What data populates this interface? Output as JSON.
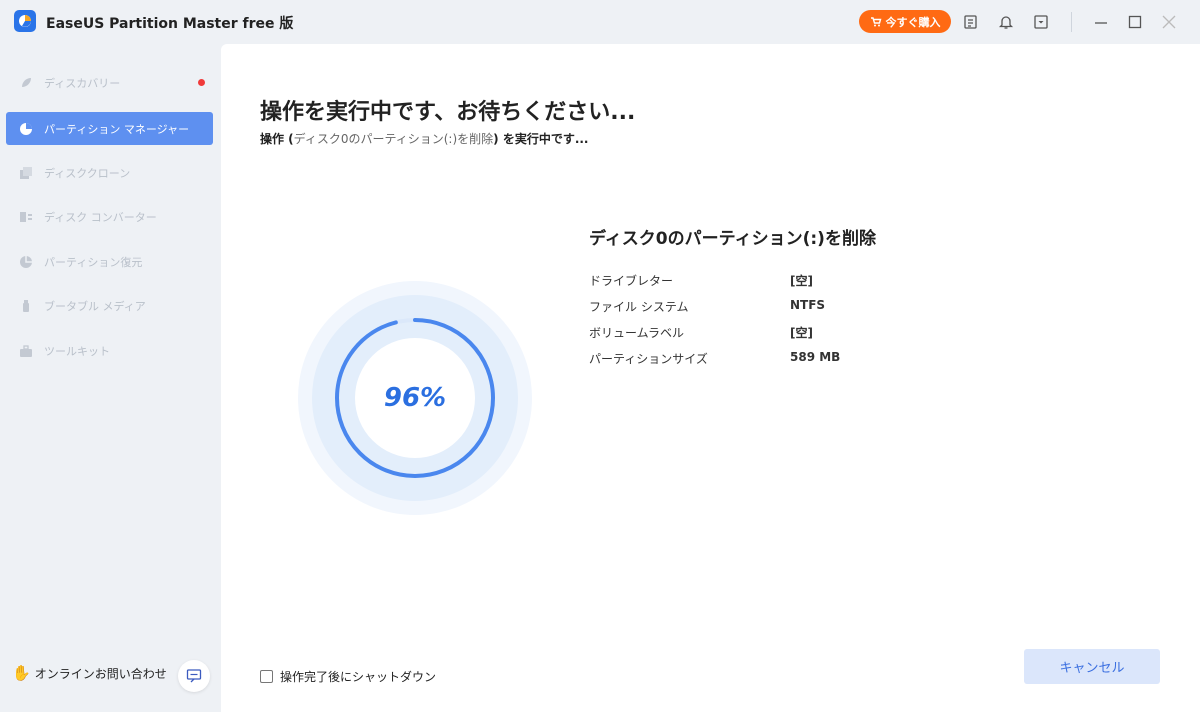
{
  "app": {
    "title": "EaseUS Partition Master free 版"
  },
  "toolbar": {
    "buy_label": "今すぐ購入"
  },
  "sidebar": {
    "items": [
      {
        "label": "ディスカバリー",
        "icon": "rocket-icon",
        "active": false,
        "badge": true
      },
      {
        "label": "パーティション マネージャー",
        "icon": "pie-chart-icon",
        "active": true
      },
      {
        "label": "ディスククローン",
        "icon": "clone-icon",
        "active": false
      },
      {
        "label": "ディスク コンバーター",
        "icon": "converter-icon",
        "active": false
      },
      {
        "label": "パーティション復元",
        "icon": "recovery-icon",
        "active": false
      },
      {
        "label": "ブータブル メディア",
        "icon": "usb-icon",
        "active": false
      },
      {
        "label": "ツールキット",
        "icon": "toolkit-icon",
        "active": false
      }
    ],
    "support_label": "オンラインお問い合わせ"
  },
  "main": {
    "title": "操作を実行中です、お待ちください...",
    "subtitle_prefix": "操作 (",
    "subtitle_op": "ディスク0のパーティション(:)を削除",
    "subtitle_suffix": ") を実行中です...",
    "progress_text": "96%",
    "progress_value": 0.96,
    "detail_title": "ディスク0のパーティション(:)を削除",
    "details": [
      {
        "label": "ドライブレター",
        "value": "[空]"
      },
      {
        "label": "ファイル システム",
        "value": "NTFS"
      },
      {
        "label": "ボリュームラベル",
        "value": "[空]"
      },
      {
        "label": "パーティションサイズ",
        "value": "589 MB"
      }
    ],
    "shutdown_label": "操作完了後にシャットダウン",
    "cancel_label": "キャンセル"
  },
  "colors": {
    "accent": "#5e90f0",
    "buy": "#ff6a13",
    "progress": "#2b6fe0"
  }
}
